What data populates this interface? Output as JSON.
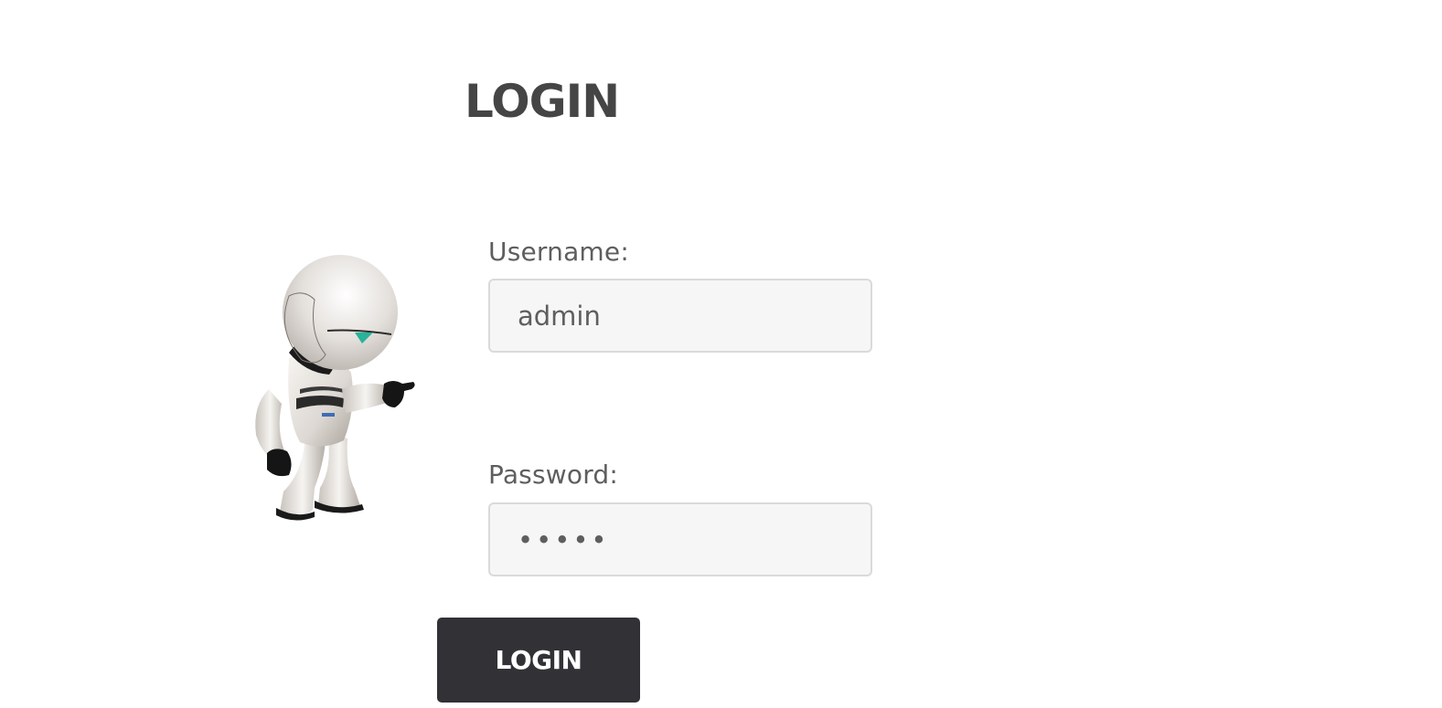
{
  "page": {
    "title": "LOGIN"
  },
  "mascot": {
    "icon": "robot-mascot-icon"
  },
  "form": {
    "username": {
      "label": "Username:",
      "value": "admin"
    },
    "password": {
      "label": "Password:",
      "value": "•••••",
      "masked_length": 5
    },
    "submit_label": "LOGIN"
  },
  "colors": {
    "button_background": "#323136",
    "input_background": "#f6f6f6",
    "input_border": "#dadada",
    "title_text": "#454545",
    "label_text": "#5e5e5e"
  }
}
